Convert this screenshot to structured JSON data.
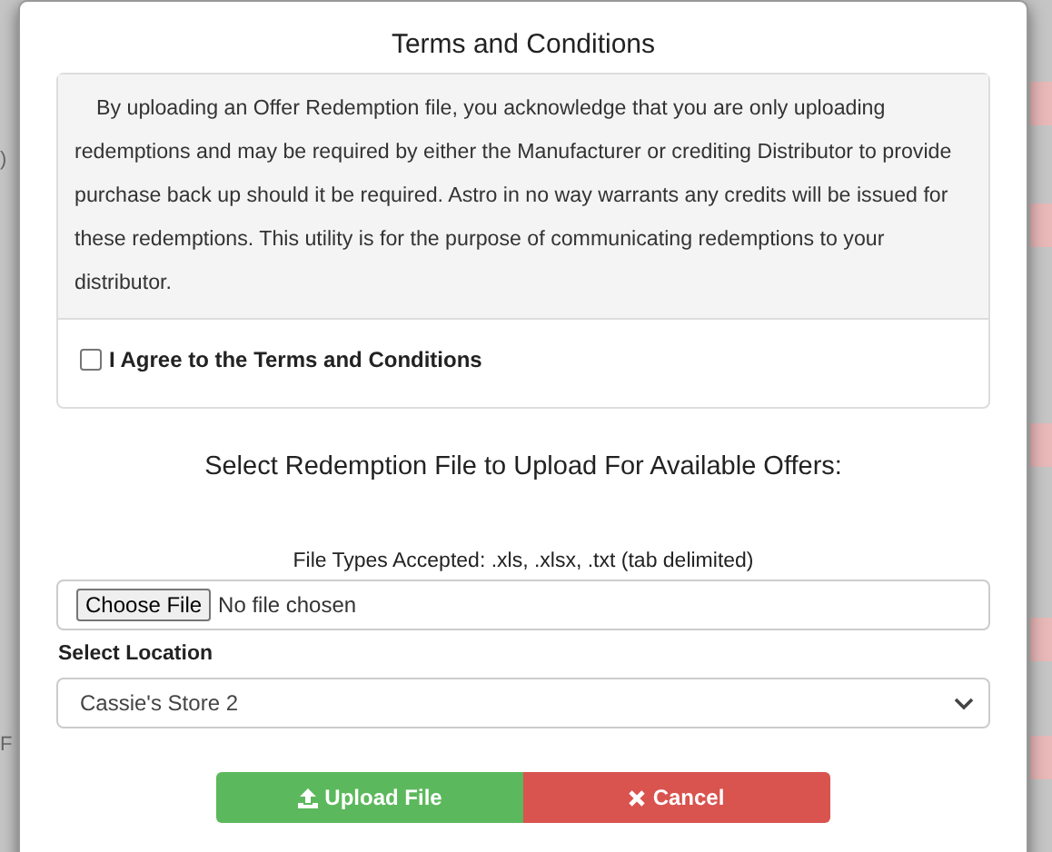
{
  "background": {
    "fragments": [
      {
        "text": ")",
        "kind": "plain"
      },
      {
        "text": "F",
        "kind": "plain"
      }
    ]
  },
  "modal": {
    "title": "Terms and Conditions",
    "terms": {
      "text": "By uploading an Offer Redemption file, you acknowledge that you are only uploading redemptions and may be required by either the Manufacturer or crediting Distributor to provide purchase back up should it be required. Astro in no way warrants any credits will be issued for these redemptions. This utility is for the purpose of communicating redemptions to your distributor.",
      "agree": {
        "label": "I Agree to the Terms and Conditions",
        "checked": false
      }
    },
    "heading": "Select Redemption File to Upload For Available Offers:",
    "file_types": "File Types Accepted: .xls, .xlsx, .txt (tab delimited)",
    "file_input": {
      "button": "Choose File",
      "status": "No file chosen"
    },
    "location": {
      "label": "Select Location",
      "value": "Cassie's Store 2"
    },
    "buttons": [
      {
        "label": "Upload File",
        "kind": "upload"
      },
      {
        "label": "Cancel",
        "kind": "cancel"
      }
    ]
  }
}
